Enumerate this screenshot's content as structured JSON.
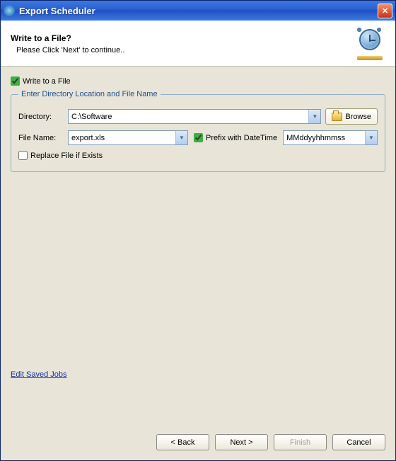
{
  "window": {
    "title": "Export Scheduler"
  },
  "header": {
    "title": "Write to a File?",
    "subtitle": "Please Click 'Next' to continue.."
  },
  "controls": {
    "write_to_file_label": "Write to a File",
    "write_to_file_checked": true,
    "group_legend": "Enter Directory Location and File Name",
    "directory_label": "Directory:",
    "directory_value": "C:\\Software",
    "browse_label": "Browse",
    "filename_label": "File Name:",
    "filename_value": "export.xls",
    "prefix_label": "Prefix with DateTime",
    "prefix_checked": true,
    "dt_format_value": "MMddyyhhmmss",
    "replace_label": "Replace File if Exists",
    "replace_checked": false
  },
  "link": {
    "edit_jobs": "Edit Saved Jobs"
  },
  "buttons": {
    "back": "< Back",
    "next": "Next >",
    "finish": "Finish",
    "cancel": "Cancel"
  }
}
